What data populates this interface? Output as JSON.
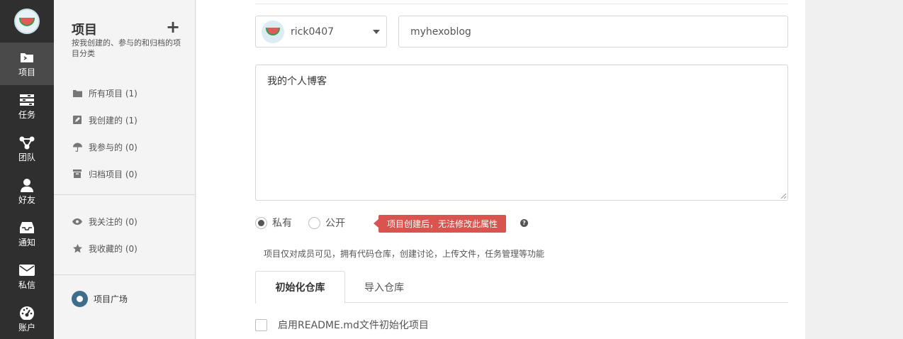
{
  "nav": {
    "logo": "watermelon-logo",
    "items": [
      {
        "label": "项目",
        "icon": "folder-icon",
        "active": true
      },
      {
        "label": "任务",
        "icon": "tasks-icon",
        "active": false
      },
      {
        "label": "团队",
        "icon": "team-icon",
        "active": false
      },
      {
        "label": "好友",
        "icon": "user-icon",
        "active": false
      },
      {
        "label": "通知",
        "icon": "inbox-icon",
        "active": false
      },
      {
        "label": "私信",
        "icon": "envelope-icon",
        "active": false
      },
      {
        "label": "账户",
        "icon": "dashboard-icon",
        "active": false
      }
    ]
  },
  "sidebar": {
    "title": "项目",
    "plus": "+",
    "subtitle": "按我创建的、参与的和归档的项目分类",
    "items": [
      {
        "label": "所有项目 (1)",
        "icon": "folder-icon"
      },
      {
        "label": "我创建的 (1)",
        "icon": "edit-icon"
      },
      {
        "label": "我参与的 (0)",
        "icon": "umbrella-icon"
      },
      {
        "label": "归档项目 (0)",
        "icon": "archive-icon"
      }
    ],
    "items2": [
      {
        "label": "我关注的 (0)",
        "icon": "eye-icon"
      },
      {
        "label": "我收藏的 (0)",
        "icon": "star-icon"
      }
    ],
    "plaza_label": "项目广场"
  },
  "form": {
    "owner": "rick0407",
    "project_name": "myhexoblog",
    "description": "我的个人博客",
    "visibility": {
      "private_label": "私有",
      "public_label": "公开",
      "selected": "私有"
    },
    "tip": "项目创建后，无法修改此属性",
    "help": "?",
    "note": "项目仅对成员可见，拥有代码仓库，创建讨论，上传文件，任务管理等功能",
    "tabs": [
      {
        "label": "初始化仓库",
        "active": true
      },
      {
        "label": "导入仓库",
        "active": false
      }
    ],
    "readme_label": "启用README.md文件初始化项目"
  },
  "colors": {
    "nav_bg": "#2f2f2f",
    "nav_active": "#4a4a4a",
    "tip_bg": "#d9534f",
    "plaza_icon": "#3f6e8c"
  }
}
